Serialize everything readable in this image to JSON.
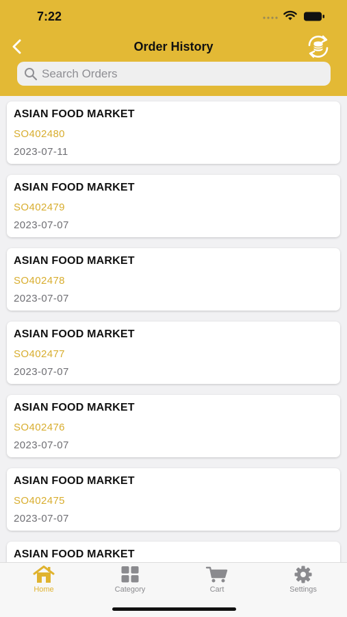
{
  "status_bar": {
    "time": "7:22"
  },
  "header": {
    "title": "Order History",
    "search_placeholder": "Search Orders"
  },
  "orders": [
    {
      "customer": "ASIAN FOOD MARKET",
      "number": "SO402480",
      "date": "2023-07-11"
    },
    {
      "customer": "ASIAN FOOD MARKET",
      "number": "SO402479",
      "date": "2023-07-07"
    },
    {
      "customer": "ASIAN FOOD MARKET",
      "number": "SO402478",
      "date": "2023-07-07"
    },
    {
      "customer": "ASIAN FOOD MARKET",
      "number": "SO402477",
      "date": "2023-07-07"
    },
    {
      "customer": "ASIAN FOOD MARKET",
      "number": "SO402476",
      "date": "2023-07-07"
    },
    {
      "customer": "ASIAN FOOD MARKET",
      "number": "SO402475",
      "date": "2023-07-07"
    },
    {
      "customer": "ASIAN FOOD MARKET",
      "number": "",
      "date": ""
    }
  ],
  "tabs": [
    {
      "label": "Home",
      "icon": "home-icon",
      "active": true
    },
    {
      "label": "Category",
      "icon": "grid-icon",
      "active": false
    },
    {
      "label": "Cart",
      "icon": "cart-icon",
      "active": false
    },
    {
      "label": "Settings",
      "icon": "gear-icon",
      "active": false
    }
  ],
  "colors": {
    "header_bg": "#e3b935",
    "accent": "#d8ad2e",
    "date_text": "#6e6e73",
    "inactive_tab": "#8a8a8e"
  }
}
